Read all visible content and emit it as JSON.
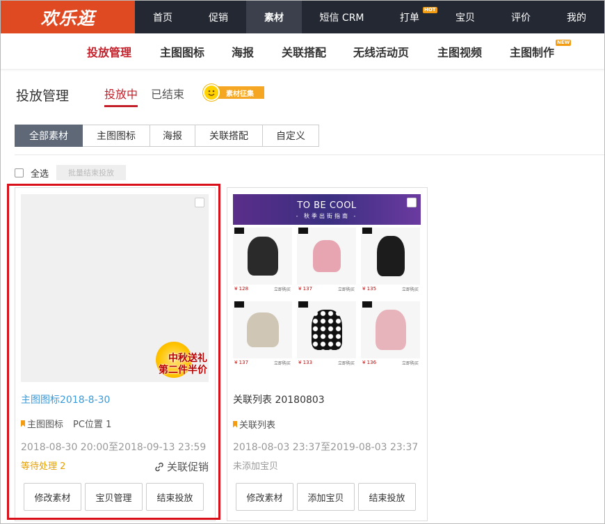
{
  "app": {
    "logo": "欢乐逛"
  },
  "topnav": [
    {
      "label": "首页"
    },
    {
      "label": "促销"
    },
    {
      "label": "素材",
      "active": true
    },
    {
      "label": "短信 CRM"
    },
    {
      "label": "打单",
      "badge": "HOT"
    },
    {
      "label": "宝贝"
    },
    {
      "label": "评价"
    },
    {
      "label": "我的"
    }
  ],
  "subnav": [
    {
      "label": "投放管理",
      "active": true
    },
    {
      "label": "主图图标"
    },
    {
      "label": "海报"
    },
    {
      "label": "关联搭配"
    },
    {
      "label": "无线活动页"
    },
    {
      "label": "主图视频"
    },
    {
      "label": "主图制作",
      "badge": "NEW"
    }
  ],
  "page": {
    "title": "投放管理",
    "tabs": [
      {
        "label": "投放中",
        "active": true
      },
      {
        "label": "已结束"
      }
    ],
    "collect_label": "素材征集"
  },
  "filters": [
    {
      "label": "全部素材",
      "active": true
    },
    {
      "label": "主图图标"
    },
    {
      "label": "海报"
    },
    {
      "label": "关联搭配"
    },
    {
      "label": "自定义"
    }
  ],
  "toolbar": {
    "select_all": "全选",
    "batch_end": "批量结束投放"
  },
  "cards": [
    {
      "title": "主图图标2018-8-30",
      "type": "主图图标",
      "position": "PC位置 1",
      "date": "2018-08-30 20:00至2018-09-13 23:59",
      "status": "等待处理 2",
      "link": "关联促销",
      "promo_line1": "中秋送礼",
      "promo_line2": "第二件半价",
      "actions": [
        "修改素材",
        "宝贝管理",
        "结束投放"
      ]
    },
    {
      "title": "关联列表 20180803",
      "type": "关联列表",
      "date": "2018-08-03 23:37至2019-08-03 23:37",
      "status": "未添加宝贝",
      "banner_title": "TO BE COOL",
      "banner_sub": "- 秋季出街指南 -",
      "products": [
        {
          "price": "¥ 128",
          "buy": "立即购买",
          "color": "#2a2a2a"
        },
        {
          "price": "¥ 137",
          "buy": "立即购买",
          "color": "#e6a5b0"
        },
        {
          "price": "¥ 135",
          "buy": "立即购买",
          "color": "#1c1c1c"
        },
        {
          "price": "¥ 137",
          "buy": "立即购买",
          "color": "#cfc6b5"
        },
        {
          "price": "¥ 133",
          "buy": "立即购买",
          "color": "#111111"
        },
        {
          "price": "¥ 136",
          "buy": "立即购买",
          "color": "#e8b4bc"
        }
      ],
      "actions": [
        "修改素材",
        "添加宝贝",
        "结束投放"
      ]
    }
  ],
  "colors": {
    "accent": "#c4202a",
    "logo_bg": "#e04a22",
    "topbar": "#242833",
    "link_blue": "#3a9ad9",
    "warn": "#e8a000"
  }
}
